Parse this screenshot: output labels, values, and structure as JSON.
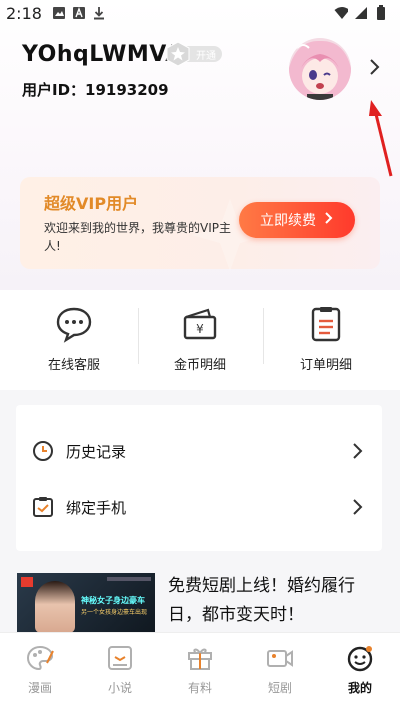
{
  "status_bar": {
    "time": "2:18"
  },
  "profile": {
    "username": "YOhqLWMVA",
    "vip_badge_label": "开通",
    "user_id": "用户ID：19193209"
  },
  "vip_card": {
    "title": "超级VIP用户",
    "description": "欢迎来到我的世界，我尊贵的VIP主人!",
    "button_label": "立即续费"
  },
  "quick_actions": [
    {
      "label": "在线客服",
      "icon": "chat-bubble-icon"
    },
    {
      "label": "金币明细",
      "icon": "wallet-icon"
    },
    {
      "label": "订单明细",
      "icon": "order-clipboard-icon"
    }
  ],
  "menu": [
    {
      "label": "历史记录",
      "icon": "clock-icon"
    },
    {
      "label": "绑定手机",
      "icon": "bind-phone-icon"
    }
  ],
  "promo": {
    "headline": "免费短剧上线！婚约履行日，都市变天时！",
    "thumb_caption": "神秘女子身边豪车",
    "thumb_subcaption": "另一个女孩身边豪车出现"
  },
  "bottom_nav": [
    {
      "label": "漫画",
      "icon": "palette-icon",
      "active": false
    },
    {
      "label": "小说",
      "icon": "book-icon",
      "active": false
    },
    {
      "label": "有料",
      "icon": "gift-icon",
      "active": false
    },
    {
      "label": "短剧",
      "icon": "video-camera-icon",
      "active": false
    },
    {
      "label": "我的",
      "icon": "smiley-face-icon",
      "active": true
    }
  ],
  "colors": {
    "vip_gold": "#e28a28",
    "renew_button": "#ff4a30",
    "annotation_arrow": "#e02020",
    "icon_dark": "#333333",
    "icon_inactive": "#b0b0b0"
  }
}
